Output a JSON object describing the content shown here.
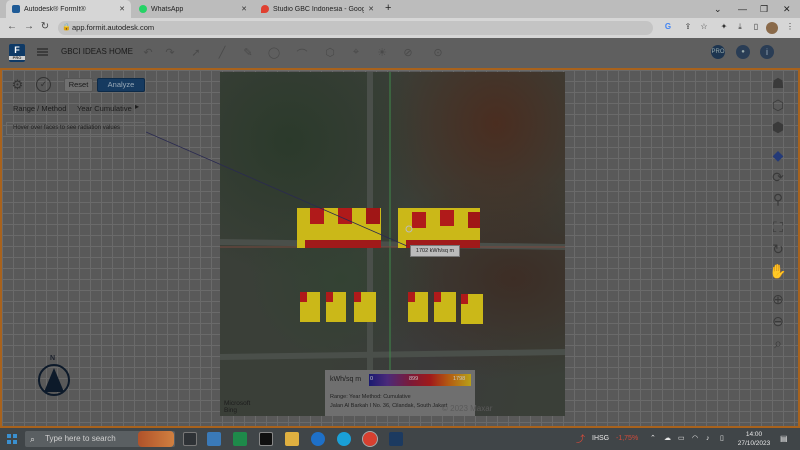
{
  "browser": {
    "tabs": [
      {
        "label": "Autodesk® FormIt®",
        "active": true,
        "favicon_color": "#1e5a96"
      },
      {
        "label": "WhatsApp",
        "active": false,
        "favicon_color": "#25d366"
      },
      {
        "label": "Studio GBC Indonesia - Google",
        "active": false,
        "favicon_color": "#e04030"
      }
    ],
    "url": "app.formit.autodesk.com"
  },
  "app": {
    "logo_letter": "F",
    "logo_sub": "PRO",
    "project_title": "GBCI IDEAS HOME",
    "toolbar_right": [
      "pro-badge",
      "user-avatar",
      "info-icon"
    ],
    "pro_label": "PRO"
  },
  "panel": {
    "reset_label": "Reset",
    "analyze_label": "Analyze",
    "range_label": "Range / Method",
    "range_value": "Year Cumulative",
    "hint": "Hover over faces to see radiation values"
  },
  "tooltip": "1702 kWh/sq m",
  "legend": {
    "unit": "kWh/sq m",
    "min": "0",
    "mid": "899",
    "max": "1798",
    "range_line": "Range:  Year   Method:  Cumulative",
    "address": "Jalan Al Barkah I No. 36, Cilandak, South Jakart"
  },
  "map": {
    "provider_line1": "Microsoft",
    "provider_line2": "Bing",
    "copyright": "© 2023 Maxar"
  },
  "compass": {
    "north_label": "N"
  },
  "taskbar": {
    "search_placeholder": "Type here to search",
    "stock_name": "IHSG",
    "stock_change": "-1,75%",
    "time": "14:00",
    "date": "27/10/2023"
  },
  "colors": {
    "accent_orange": "#a8621c",
    "analyze_blue": "#163a60",
    "roof_yellow": "#cbb818",
    "roof_red": "#b01a1a",
    "stock_red": "#d24a3a"
  }
}
